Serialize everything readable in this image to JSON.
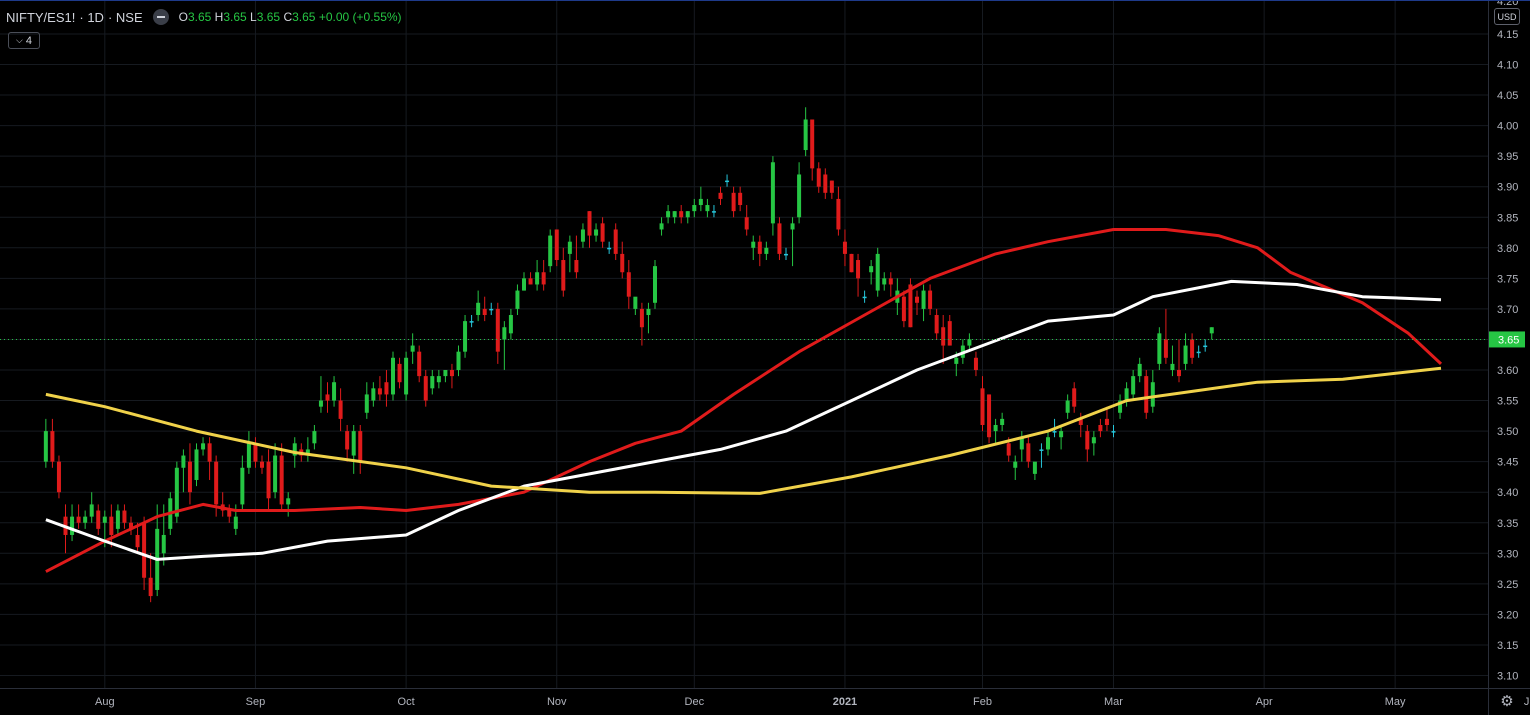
{
  "header": {
    "symbol": "NIFTY/ES1!",
    "timeframe": "1D",
    "exchange": "NSE",
    "ohlc": {
      "o_label": "O",
      "o": "3.65",
      "h_label": "H",
      "h": "3.65",
      "l_label": "L",
      "l": "3.65",
      "c_label": "C",
      "c": "3.65",
      "change": "+0.00 (+0.55%)"
    },
    "indicator_count": "4",
    "indicator_chevron": "chevron-down-icon"
  },
  "currency_label": "USD",
  "price_axis": {
    "ticks": [
      "3.10",
      "3.15",
      "3.20",
      "3.25",
      "3.30",
      "3.35",
      "3.40",
      "3.45",
      "3.50",
      "3.55",
      "3.60",
      "3.65",
      "3.70",
      "3.75",
      "3.80",
      "3.85",
      "3.90",
      "3.95",
      "4.00",
      "4.05",
      "4.10",
      "4.15"
    ],
    "top_partial_label": "4.20",
    "last_price_label": "3.65",
    "last_price_color": "#26c644"
  },
  "time_axis": {
    "labels": [
      {
        "text": "Aug",
        "bar": 16
      },
      {
        "text": "Sep",
        "bar": 39
      },
      {
        "text": "Oct",
        "bar": 62
      },
      {
        "text": "Nov",
        "bar": 85
      },
      {
        "text": "Dec",
        "bar": 106
      },
      {
        "text": "2021",
        "bar": 129
      },
      {
        "text": "Feb",
        "bar": 150
      },
      {
        "text": "Mar",
        "bar": 170
      },
      {
        "text": "Apr",
        "bar": 193
      },
      {
        "text": "May",
        "bar": 213
      },
      {
        "text": "Jun",
        "bar": 234
      }
    ]
  },
  "colors": {
    "up": "#26c644",
    "down": "#e01b1b",
    "doji": "#26c6da",
    "ma_red": "#e01b1b",
    "ma_white": "#ffffff",
    "ma_yellow": "#f0d24a",
    "grid": "#161a20",
    "axis_text": "#b2b5be"
  },
  "chart_data": {
    "type": "candlestick",
    "title": "NIFTY/ES1! · 1D · NSE",
    "ylim": [
      3.08,
      4.21
    ],
    "x_start_bar": 7,
    "moving_averages": [
      {
        "name": "MA red",
        "color": "#e01b1b",
        "points": [
          [
            7,
            3.27
          ],
          [
            16,
            3.32
          ],
          [
            24,
            3.36
          ],
          [
            31,
            3.38
          ],
          [
            36,
            3.37
          ],
          [
            45,
            3.37
          ],
          [
            55,
            3.375
          ],
          [
            62,
            3.37
          ],
          [
            70,
            3.38
          ],
          [
            80,
            3.4
          ],
          [
            90,
            3.45
          ],
          [
            97,
            3.48
          ],
          [
            104,
            3.5
          ],
          [
            112,
            3.56
          ],
          [
            122,
            3.63
          ],
          [
            132,
            3.69
          ],
          [
            142,
            3.75
          ],
          [
            147,
            3.77
          ],
          [
            152,
            3.79
          ],
          [
            160,
            3.81
          ],
          [
            170,
            3.83
          ],
          [
            178,
            3.83
          ],
          [
            186,
            3.82
          ],
          [
            192,
            3.8
          ],
          [
            197,
            3.76
          ],
          [
            208,
            3.71
          ],
          [
            215,
            3.66
          ],
          [
            220,
            3.61
          ]
        ]
      },
      {
        "name": "MA white",
        "color": "#ffffff",
        "points": [
          [
            7,
            3.355
          ],
          [
            16,
            3.32
          ],
          [
            24,
            3.29
          ],
          [
            31,
            3.295
          ],
          [
            40,
            3.3
          ],
          [
            50,
            3.32
          ],
          [
            62,
            3.33
          ],
          [
            70,
            3.37
          ],
          [
            80,
            3.41
          ],
          [
            90,
            3.43
          ],
          [
            100,
            3.45
          ],
          [
            110,
            3.47
          ],
          [
            120,
            3.5
          ],
          [
            130,
            3.55
          ],
          [
            140,
            3.6
          ],
          [
            150,
            3.64
          ],
          [
            160,
            3.68
          ],
          [
            170,
            3.69
          ],
          [
            176,
            3.72
          ],
          [
            188,
            3.745
          ],
          [
            198,
            3.74
          ],
          [
            208,
            3.72
          ],
          [
            220,
            3.715
          ]
        ]
      },
      {
        "name": "MA yellow",
        "color": "#f0d24a",
        "points": [
          [
            7,
            3.56
          ],
          [
            16,
            3.54
          ],
          [
            30,
            3.5
          ],
          [
            45,
            3.465
          ],
          [
            62,
            3.44
          ],
          [
            75,
            3.41
          ],
          [
            90,
            3.4
          ],
          [
            100,
            3.4
          ],
          [
            116,
            3.398
          ],
          [
            130,
            3.425
          ],
          [
            145,
            3.46
          ],
          [
            160,
            3.5
          ],
          [
            172,
            3.55
          ],
          [
            182,
            3.565
          ],
          [
            192,
            3.58
          ],
          [
            205,
            3.585
          ],
          [
            220,
            3.603
          ]
        ]
      }
    ],
    "candles": [
      [
        3.45,
        3.52,
        3.44,
        3.5
      ],
      [
        3.5,
        3.52,
        3.44,
        3.45
      ],
      [
        3.45,
        3.46,
        3.39,
        3.4
      ],
      [
        3.36,
        3.38,
        3.3,
        3.33
      ],
      [
        3.33,
        3.38,
        3.32,
        3.36
      ],
      [
        3.36,
        3.38,
        3.34,
        3.35
      ],
      [
        3.35,
        3.37,
        3.34,
        3.36
      ],
      [
        3.36,
        3.4,
        3.35,
        3.38
      ],
      [
        3.37,
        3.38,
        3.33,
        3.34
      ],
      [
        3.35,
        3.37,
        3.31,
        3.36
      ],
      [
        3.36,
        3.38,
        3.31,
        3.33
      ],
      [
        3.34,
        3.38,
        3.33,
        3.37
      ],
      [
        3.37,
        3.38,
        3.34,
        3.35
      ],
      [
        3.35,
        3.36,
        3.33,
        3.34
      ],
      [
        3.33,
        3.35,
        3.3,
        3.31
      ],
      [
        3.35,
        3.36,
        3.24,
        3.26
      ],
      [
        3.26,
        3.3,
        3.22,
        3.23
      ],
      [
        3.24,
        3.38,
        3.23,
        3.34
      ],
      [
        3.3,
        3.38,
        3.28,
        3.33
      ],
      [
        3.34,
        3.4,
        3.33,
        3.39
      ],
      [
        3.36,
        3.45,
        3.35,
        3.44
      ],
      [
        3.44,
        3.47,
        3.4,
        3.46
      ],
      [
        3.45,
        3.48,
        3.38,
        3.4
      ],
      [
        3.42,
        3.48,
        3.41,
        3.47
      ],
      [
        3.47,
        3.49,
        3.46,
        3.48
      ],
      [
        3.48,
        3.49,
        3.42,
        3.45
      ],
      [
        3.45,
        3.46,
        3.36,
        3.38
      ],
      [
        3.38,
        3.4,
        3.36,
        3.37
      ],
      [
        3.37,
        3.38,
        3.35,
        3.36
      ],
      [
        3.34,
        3.38,
        3.33,
        3.36
      ],
      [
        3.38,
        3.46,
        3.37,
        3.44
      ],
      [
        3.44,
        3.5,
        3.43,
        3.48
      ],
      [
        3.48,
        3.49,
        3.44,
        3.45
      ],
      [
        3.45,
        3.46,
        3.43,
        3.44
      ],
      [
        3.45,
        3.47,
        3.37,
        3.39
      ],
      [
        3.4,
        3.48,
        3.39,
        3.46
      ],
      [
        3.46,
        3.48,
        3.37,
        3.38
      ],
      [
        3.38,
        3.4,
        3.36,
        3.39
      ],
      [
        3.46,
        3.49,
        3.44,
        3.48
      ],
      [
        3.47,
        3.48,
        3.45,
        3.46
      ],
      [
        3.46,
        3.49,
        3.45,
        3.47
      ],
      [
        3.48,
        3.51,
        3.47,
        3.5
      ],
      [
        3.54,
        3.59,
        3.53,
        3.55
      ],
      [
        3.56,
        3.58,
        3.53,
        3.55
      ],
      [
        3.55,
        3.59,
        3.54,
        3.58
      ],
      [
        3.55,
        3.57,
        3.5,
        3.52
      ],
      [
        3.5,
        3.51,
        3.45,
        3.47
      ],
      [
        3.46,
        3.51,
        3.43,
        3.5
      ],
      [
        3.5,
        3.51,
        3.43,
        3.45
      ],
      [
        3.53,
        3.58,
        3.52,
        3.56
      ],
      [
        3.55,
        3.58,
        3.54,
        3.57
      ],
      [
        3.57,
        3.59,
        3.55,
        3.56
      ],
      [
        3.58,
        3.6,
        3.54,
        3.56
      ],
      [
        3.56,
        3.63,
        3.55,
        3.62
      ],
      [
        3.61,
        3.62,
        3.57,
        3.58
      ],
      [
        3.56,
        3.63,
        3.55,
        3.62
      ],
      [
        3.63,
        3.66,
        3.61,
        3.64
      ],
      [
        3.63,
        3.64,
        3.58,
        3.59
      ],
      [
        3.59,
        3.6,
        3.54,
        3.55
      ],
      [
        3.57,
        3.6,
        3.56,
        3.59
      ],
      [
        3.58,
        3.6,
        3.57,
        3.59
      ],
      [
        3.59,
        3.6,
        3.58,
        3.6
      ],
      [
        3.6,
        3.61,
        3.57,
        3.59
      ],
      [
        3.6,
        3.64,
        3.59,
        3.63
      ],
      [
        3.63,
        3.69,
        3.62,
        3.68
      ],
      [
        3.68,
        3.69,
        3.67,
        3.68
      ],
      [
        3.69,
        3.73,
        3.68,
        3.71
      ],
      [
        3.7,
        3.72,
        3.68,
        3.69
      ],
      [
        3.7,
        3.71,
        3.69,
        3.7
      ],
      [
        3.7,
        3.71,
        3.61,
        3.63
      ],
      [
        3.65,
        3.68,
        3.6,
        3.67
      ],
      [
        3.66,
        3.7,
        3.65,
        3.69
      ],
      [
        3.7,
        3.74,
        3.69,
        3.73
      ],
      [
        3.73,
        3.76,
        3.73,
        3.75
      ],
      [
        3.75,
        3.76,
        3.74,
        3.74
      ],
      [
        3.74,
        3.78,
        3.73,
        3.76
      ],
      [
        3.76,
        3.78,
        3.73,
        3.74
      ],
      [
        3.77,
        3.83,
        3.76,
        3.82
      ],
      [
        3.83,
        3.83,
        3.77,
        3.78
      ],
      [
        3.78,
        3.8,
        3.72,
        3.73
      ],
      [
        3.79,
        3.82,
        3.76,
        3.81
      ],
      [
        3.78,
        3.82,
        3.75,
        3.76
      ],
      [
        3.81,
        3.84,
        3.8,
        3.83
      ],
      [
        3.86,
        3.86,
        3.8,
        3.82
      ],
      [
        3.82,
        3.84,
        3.81,
        3.83
      ],
      [
        3.84,
        3.85,
        3.8,
        3.81
      ],
      [
        3.8,
        3.81,
        3.79,
        3.8
      ],
      [
        3.83,
        3.84,
        3.78,
        3.79
      ],
      [
        3.79,
        3.81,
        3.75,
        3.76
      ],
      [
        3.76,
        3.78,
        3.7,
        3.72
      ],
      [
        3.7,
        3.71,
        3.69,
        3.72
      ],
      [
        3.7,
        3.71,
        3.64,
        3.67
      ],
      [
        3.69,
        3.71,
        3.66,
        3.7
      ],
      [
        3.71,
        3.78,
        3.7,
        3.77
      ],
      [
        3.83,
        3.85,
        3.82,
        3.84
      ],
      [
        3.85,
        3.87,
        3.84,
        3.86
      ],
      [
        3.85,
        3.86,
        3.84,
        3.86
      ],
      [
        3.86,
        3.87,
        3.84,
        3.85
      ],
      [
        3.85,
        3.86,
        3.84,
        3.86
      ],
      [
        3.86,
        3.88,
        3.85,
        3.87
      ],
      [
        3.87,
        3.9,
        3.86,
        3.88
      ],
      [
        3.86,
        3.88,
        3.85,
        3.87
      ],
      [
        3.86,
        3.87,
        3.85,
        3.86
      ],
      [
        3.89,
        3.9,
        3.87,
        3.88
      ],
      [
        3.91,
        3.92,
        3.9,
        3.91
      ],
      [
        3.89,
        3.9,
        3.85,
        3.86
      ],
      [
        3.89,
        3.9,
        3.86,
        3.87
      ],
      [
        3.85,
        3.87,
        3.82,
        3.83
      ],
      [
        3.8,
        3.82,
        3.78,
        3.81
      ],
      [
        3.81,
        3.82,
        3.77,
        3.79
      ],
      [
        3.79,
        3.81,
        3.78,
        3.8
      ],
      [
        3.84,
        3.95,
        3.82,
        3.94
      ],
      [
        3.84,
        3.85,
        3.78,
        3.79
      ],
      [
        3.79,
        3.8,
        3.78,
        3.79
      ],
      [
        3.83,
        3.85,
        3.77,
        3.84
      ],
      [
        3.85,
        3.94,
        3.84,
        3.92
      ],
      [
        3.96,
        4.03,
        3.95,
        4.01
      ],
      [
        4.01,
        4.01,
        3.91,
        3.93
      ],
      [
        3.93,
        3.94,
        3.89,
        3.9
      ],
      [
        3.92,
        3.93,
        3.88,
        3.89
      ],
      [
        3.91,
        3.91,
        3.88,
        3.89
      ],
      [
        3.88,
        3.9,
        3.82,
        3.83
      ],
      [
        3.81,
        3.83,
        3.77,
        3.79
      ],
      [
        3.79,
        3.79,
        3.76,
        3.76
      ],
      [
        3.78,
        3.79,
        3.72,
        3.75
      ],
      [
        3.72,
        3.73,
        3.71,
        3.72
      ],
      [
        3.76,
        3.78,
        3.74,
        3.77
      ],
      [
        3.73,
        3.8,
        3.72,
        3.79
      ],
      [
        3.74,
        3.76,
        3.73,
        3.75
      ],
      [
        3.75,
        3.76,
        3.72,
        3.74
      ],
      [
        3.71,
        3.75,
        3.69,
        3.73
      ],
      [
        3.72,
        3.73,
        3.67,
        3.68
      ],
      [
        3.74,
        3.75,
        3.67,
        3.67
      ],
      [
        3.72,
        3.73,
        3.69,
        3.71
      ],
      [
        3.7,
        3.74,
        3.68,
        3.73
      ],
      [
        3.73,
        3.74,
        3.69,
        3.7
      ],
      [
        3.69,
        3.7,
        3.65,
        3.66
      ],
      [
        3.67,
        3.69,
        3.61,
        3.64
      ],
      [
        3.68,
        3.69,
        3.64,
        3.64
      ],
      [
        3.61,
        3.63,
        3.59,
        3.62
      ],
      [
        3.62,
        3.65,
        3.61,
        3.64
      ],
      [
        3.64,
        3.66,
        3.63,
        3.65
      ],
      [
        3.62,
        3.63,
        3.59,
        3.6
      ],
      [
        3.57,
        3.59,
        3.5,
        3.51
      ],
      [
        3.56,
        3.56,
        3.48,
        3.49
      ],
      [
        3.5,
        3.52,
        3.48,
        3.51
      ],
      [
        3.51,
        3.53,
        3.5,
        3.52
      ],
      [
        3.48,
        3.49,
        3.45,
        3.46
      ],
      [
        3.44,
        3.46,
        3.42,
        3.45
      ],
      [
        3.47,
        3.5,
        3.45,
        3.49
      ],
      [
        3.48,
        3.49,
        3.44,
        3.45
      ],
      [
        3.43,
        3.44,
        3.42,
        3.45
      ],
      [
        3.47,
        3.48,
        3.44,
        3.47
      ],
      [
        3.47,
        3.5,
        3.46,
        3.49
      ],
      [
        3.5,
        3.52,
        3.49,
        3.5
      ],
      [
        3.49,
        3.51,
        3.47,
        3.5
      ],
      [
        3.53,
        3.56,
        3.52,
        3.55
      ],
      [
        3.57,
        3.58,
        3.53,
        3.54
      ],
      [
        3.52,
        3.53,
        3.49,
        3.51
      ],
      [
        3.5,
        3.51,
        3.45,
        3.47
      ],
      [
        3.48,
        3.5,
        3.46,
        3.49
      ],
      [
        3.51,
        3.52,
        3.49,
        3.5
      ],
      [
        3.52,
        3.54,
        3.5,
        3.51
      ],
      [
        3.5,
        3.51,
        3.49,
        3.5
      ],
      [
        3.53,
        3.56,
        3.52,
        3.55
      ],
      [
        3.55,
        3.58,
        3.54,
        3.57
      ],
      [
        3.56,
        3.6,
        3.55,
        3.59
      ],
      [
        3.59,
        3.62,
        3.58,
        3.61
      ],
      [
        3.59,
        3.6,
        3.52,
        3.53
      ],
      [
        3.54,
        3.6,
        3.53,
        3.58
      ],
      [
        3.61,
        3.67,
        3.6,
        3.66
      ],
      [
        3.65,
        3.7,
        3.61,
        3.62
      ],
      [
        3.6,
        3.64,
        3.59,
        3.61
      ],
      [
        3.6,
        3.65,
        3.58,
        3.59
      ],
      [
        3.61,
        3.66,
        3.6,
        3.64
      ],
      [
        3.65,
        3.66,
        3.61,
        3.62
      ],
      [
        3.63,
        3.64,
        3.62,
        3.63
      ],
      [
        3.64,
        3.65,
        3.63,
        3.64
      ],
      [
        3.66,
        3.67,
        3.65,
        3.67
      ]
    ],
    "last_price": 3.65
  }
}
